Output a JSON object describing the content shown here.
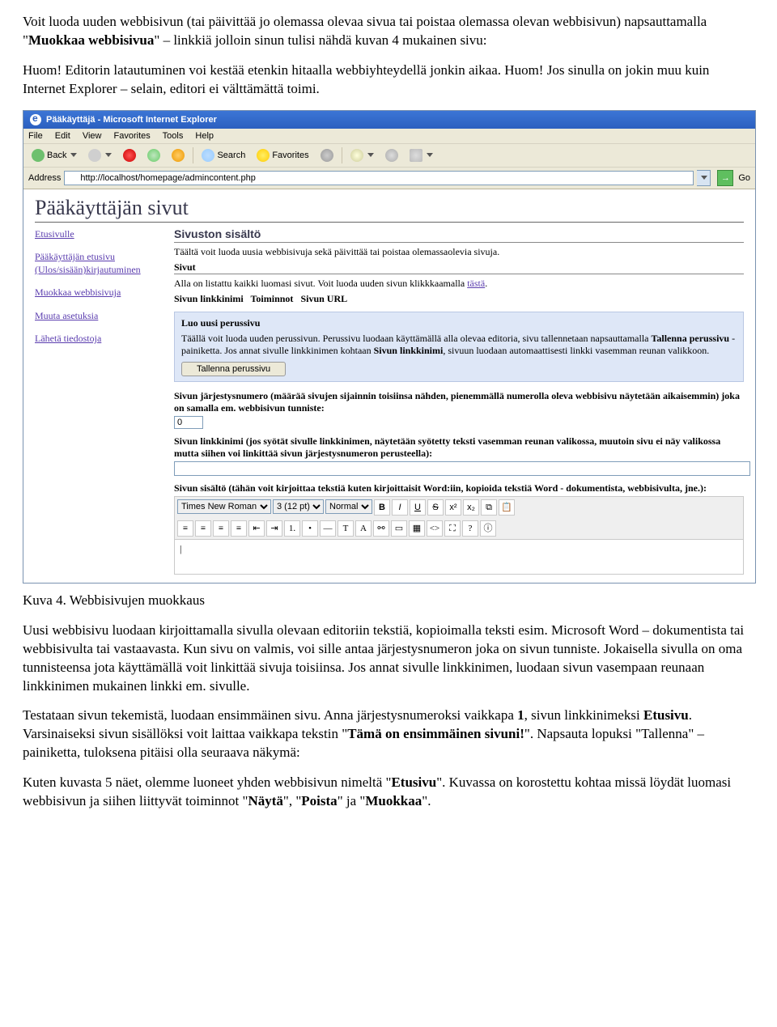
{
  "doc": {
    "p1a": "Voit luoda uuden webbisivun (tai päivittää jo olemassa olevaa sivua tai poistaa olemassa olevan webbisivun) napsauttamalla \"",
    "p1b": "Muokkaa webbisivua",
    "p1c": "\" – linkkiä jolloin sinun tulisi nähdä kuvan 4 mukainen sivu:",
    "p2": "Huom! Editorin latautuminen voi kestää etenkin hitaalla webbiyhteydellä jonkin aikaa. Huom! Jos sinulla on jokin muu kuin Internet Explorer – selain, editori ei välttämättä toimi.",
    "caption": "Kuva 4. Webbisivujen muokkaus",
    "p3": "Uusi webbisivu luodaan kirjoittamalla sivulla olevaan editoriin tekstiä, kopioimalla teksti esim. Microsoft Word – dokumentista tai webbisivulta tai vastaavasta. Kun sivu on valmis, voi sille antaa järjestysnumeron joka on sivun tunniste. Jokaisella sivulla on oma tunnisteensa jota käyttämällä voit linkittää sivuja toisiinsa. Jos annat sivulle linkkinimen, luodaan sivun vasempaan reunaan linkkinimen mukainen linkki em. sivulle.",
    "p4a": "Testataan sivun tekemistä, luodaan ensimmäinen sivu. Anna järjestysnumeroksi vaikkapa ",
    "p4b": "1",
    "p4c": ", sivun linkkinimeksi ",
    "p4d": "Etusivu",
    "p4e": ". Varsinaiseksi sivun sisällöksi voit laittaa vaikkapa tekstin \"",
    "p4f": "Tämä on ensimmäinen sivuni!",
    "p4g": "\". Napsauta lopuksi \"Tallenna\" – painiketta, tuloksena pitäisi olla seuraava näkymä:",
    "p5a": "Kuten kuvasta 5 näet, olemme luoneet yhden webbisivun nimeltä \"",
    "p5b": "Etusivu",
    "p5c": "\". Kuvassa on korostettu kohtaa missä löydät luomasi webbisivun ja siihen liittyvät toiminnot \"",
    "p5d": "Näytä",
    "p5e": "\", \"",
    "p5f": "Poista",
    "p5g": "\" ja \"",
    "p5h": "Muokkaa",
    "p5i": "\"."
  },
  "ie": {
    "title": "Pääkäyttäjä - Microsoft Internet Explorer",
    "menu": {
      "file": "File",
      "edit": "Edit",
      "view": "View",
      "favorites": "Favorites",
      "tools": "Tools",
      "help": "Help"
    },
    "toolbar": {
      "back": "Back",
      "search": "Search",
      "favorites": "Favorites"
    },
    "address_label": "Address",
    "address_value": "http://localhost/homepage/admincontent.php",
    "go": "Go"
  },
  "admin": {
    "heading": "Pääkäyttäjän sivut",
    "nav": {
      "home": "Etusivulle",
      "adminhome": "Pääkäyttäjän etusivu",
      "loginout": "(Ulos/sisään)kirjautuminen",
      "editpages": "Muokkaa webbisivuja",
      "settings": "Muuta asetuksia",
      "sendfiles": "Lähetä tiedostoja"
    },
    "main": {
      "section_title": "Sivuston sisältö",
      "section_desc": "Täältä voit luoda uusia webbisivuja sekä päivittää tai poistaa olemassaolevia sivuja.",
      "pages_label": "Sivut",
      "pages_desc_a": "Alla on listattu kaikki luomasi sivut. Voit luoda uuden sivun klikkkaamalla ",
      "pages_desc_link": "tästä",
      "pages_desc_b": ".",
      "col1": "Sivun linkkinimi",
      "col2": "Toiminnot",
      "col3": "Sivun URL",
      "band_title": "Luo uusi perussivu",
      "band_desc_a": "Täällä voit luoda uuden perussivun. Perussivu luodaan käyttämällä alla olevaa editoria, sivu tallennetaan napsauttamalla ",
      "band_bold1": "Tallenna perussivu",
      "band_desc_b": " - painiketta. Jos annat sivulle linkkinimen kohtaan ",
      "band_bold2": "Sivun linkkinimi",
      "band_desc_c": ", sivuun luodaan automaattisesti linkki vasemman reunan valikkoon.",
      "save_button": "Tallenna perussivu",
      "field_order": "Sivun järjestysnumero (määrää sivujen sijainnin toisiinsa nähden, pienemmällä numerolla oleva webbisivu näytetään aikaisemmin) joka on samalla em. webbisivun tunniste:",
      "order_value": "0",
      "field_link": "Sivun linkkinimi (jos syötät sivulle linkkinimen, näytetään syötetty teksti vasemman reunan valikossa, muutoin sivu ei näy valikossa mutta siihen voi linkittää sivun järjestysnumeron perusteella):",
      "field_content": "Sivun sisältö (tähän voit kirjoittaa tekstiä kuten kirjoittaisit Word:iin, kopioida tekstiä Word - dokumentista, webbisivulta, jne.):",
      "editor_font": "Times New Roman",
      "editor_size": "3 (12 pt)",
      "editor_format": "Normal",
      "editor_cursor": "|"
    }
  }
}
